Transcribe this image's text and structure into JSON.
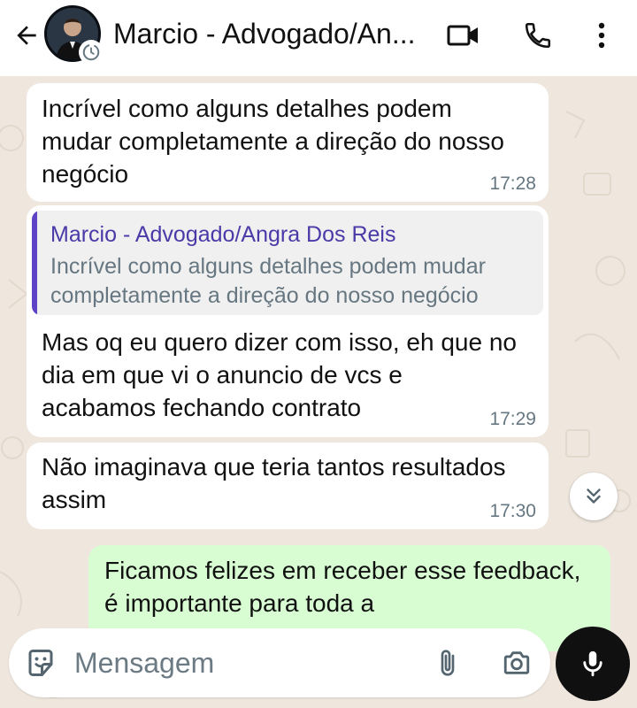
{
  "header": {
    "contact_name": "Marcio - Advogado/An...",
    "icons": {
      "back": "arrow-left-icon",
      "avatar": "contact-avatar",
      "status": "clock-icon",
      "video": "video-call-icon",
      "call": "phone-icon",
      "more": "more-vertical-icon"
    }
  },
  "messages": [
    {
      "direction": "incoming",
      "text": "Incrível como alguns detalhes podem mudar completamente a direção do nosso negócio",
      "time": "17:28"
    },
    {
      "direction": "incoming",
      "quote": {
        "author": "Marcio - Advogado/Angra Dos Reis",
        "text": "Incrível como alguns detalhes podem mudar completamente a direção do nosso negócio"
      },
      "text": "Mas oq eu quero dizer com isso, eh que no dia em que vi o anuncio de vcs e acabamos fechando contrato",
      "time": "17:29"
    },
    {
      "direction": "incoming",
      "text": "Não imaginava que teria tantos resultados assim",
      "time": "17:30"
    },
    {
      "direction": "outgoing",
      "text": "Ficamos felizes em receber esse feedback, é importante para toda a"
    }
  ],
  "scroll_button": {
    "icon": "double-chevron-down-icon"
  },
  "composer": {
    "placeholder": "Mensagem",
    "value": "",
    "icons": {
      "emoji": "sticker-icon",
      "attach": "paperclip-icon",
      "camera": "camera-icon",
      "mic": "microphone-icon"
    }
  },
  "colors": {
    "header_bg": "#ffffff",
    "chat_bg": "#efe7de",
    "incoming_bubble": "#ffffff",
    "outgoing_bubble": "#d9fdd3",
    "quote_accent": "#5e43c6",
    "timestamp": "#667781",
    "mic_button": "#101010"
  }
}
